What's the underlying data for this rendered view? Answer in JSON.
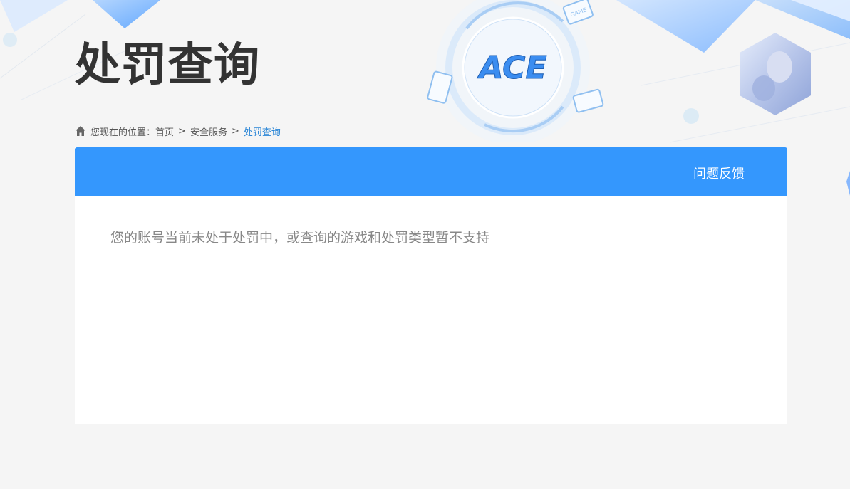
{
  "page": {
    "title": "处罚查询"
  },
  "breadcrumb": {
    "prefix": "您现在的位置：",
    "items": [
      "首页",
      "安全服务"
    ],
    "separator": ">",
    "current": "处罚查询"
  },
  "panel": {
    "feedback_label": "问题反馈",
    "message": "您的账号当前未处于处罚中，或查询的游戏和处罚类型暂不支持"
  },
  "logo": {
    "text": "ACE",
    "badge_text": "GAME"
  },
  "colors": {
    "accent": "#3497fd",
    "breadcrumb_current": "#2b86d6",
    "title": "#333333",
    "message": "#888888",
    "background": "#f5f5f5"
  }
}
